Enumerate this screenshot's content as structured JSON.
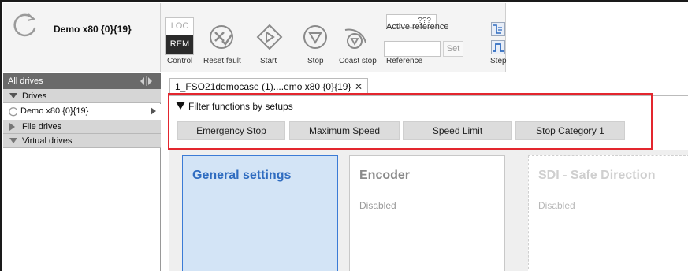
{
  "drive": {
    "title": "Demo x80 {0}{19}"
  },
  "toolbar": {
    "control": {
      "loc": "LOC",
      "rem": "REM",
      "label": "Control"
    },
    "reset_label": "Reset fault",
    "start_label": "Start",
    "stop_label": "Stop",
    "coast_label": "Coast stop",
    "reference": {
      "value": "???",
      "active_label": "Active reference",
      "set_label": "Set",
      "label": "Reference"
    },
    "step_label": "Step"
  },
  "sidebar": {
    "header": "All drives",
    "groups": [
      {
        "label": "Drives",
        "expanded": true
      },
      {
        "label": "File drives",
        "expanded": false
      },
      {
        "label": "Virtual drives",
        "expanded": true
      }
    ],
    "drive_item": "Demo x80 {0}{19}"
  },
  "tabs": [
    {
      "label": "1_FSO21democase (1)....emo x80 {0}{19}",
      "close": "✕"
    }
  ],
  "filter": {
    "title": "Filter functions by setups",
    "chips": [
      "Emergency Stop",
      "Maximum Speed",
      "Speed Limit",
      "Stop Category 1"
    ]
  },
  "cards": [
    {
      "title": "General settings",
      "status": "",
      "state": "selected"
    },
    {
      "title": "Encoder",
      "status": "Disabled",
      "state": "normal"
    },
    {
      "title": "SDI - Safe Direction",
      "status": "Disabled",
      "state": "faded"
    }
  ],
  "colors": {
    "highlight_border": "#e3262e",
    "card_selected_bg": "#d3e4f6",
    "card_selected_title": "#2f6cc0",
    "header_bg": "#6a6a6a",
    "tree_row_bg": "#d6d6d6",
    "icon_gray": "#8a8a8a",
    "icon_blue": "#2f6cc0"
  },
  "icons": {
    "drive": "loading-arc-icon",
    "reset": "reset-fault-icon",
    "start": "start-diamond-icon",
    "stop": "stop-circle-icon",
    "coast": "coast-stop-icon",
    "step_top": "step-response-icon",
    "step_bottom": "pulse-icon"
  }
}
